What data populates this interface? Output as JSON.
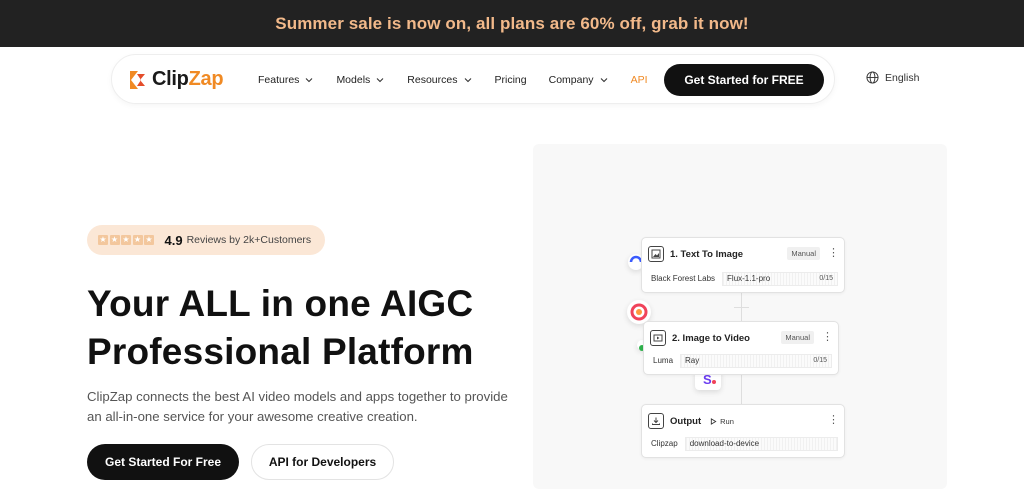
{
  "promo": {
    "text": "Summer sale is now on, all plans are 60% off, grab it now!"
  },
  "brand": {
    "name_part1": "Clip",
    "name_part2": "Zap",
    "accent": "#f08a24"
  },
  "nav": {
    "items": [
      {
        "label": "Features",
        "has_dropdown": true
      },
      {
        "label": "Models",
        "has_dropdown": true
      },
      {
        "label": "Resources",
        "has_dropdown": true
      },
      {
        "label": "Pricing",
        "has_dropdown": false
      },
      {
        "label": "Company",
        "has_dropdown": true
      },
      {
        "label": "API",
        "has_dropdown": false
      }
    ],
    "cta": "Get Started for FREE",
    "language": "English"
  },
  "rating": {
    "score": "4.9",
    "text": "Reviews by 2k+Customers",
    "stars": 5
  },
  "hero": {
    "title_line1": "Your ALL in one AIGC",
    "title_line2": "Professional Platform",
    "subtitle": "ClipZap connects the best AI video models and apps together to provide an all-in-one service for your awesome creative creation.",
    "primary_button": "Get Started For Free",
    "secondary_button": "API for Developers"
  },
  "workflow": {
    "card1": {
      "title": "1. Text To Image",
      "badge": "Manual",
      "provider": "Black Forest Labs",
      "model": "Flux-1.1-pro",
      "count": "0/15",
      "icon": "image-icon"
    },
    "card2": {
      "title": "2. Image to Video",
      "badge": "Manual",
      "provider": "Luma",
      "model": "Ray",
      "count": "0/15",
      "icon": "video-icon"
    },
    "card3": {
      "title": "Output",
      "run_label": "Run",
      "provider": "Clipzap",
      "model": "download-to-device",
      "icon": "download-icon"
    }
  },
  "colors": {
    "promo_bg": "#222222",
    "promo_text": "#f2b98a",
    "rating_bg": "#fbe7d6",
    "dark": "#111111"
  }
}
